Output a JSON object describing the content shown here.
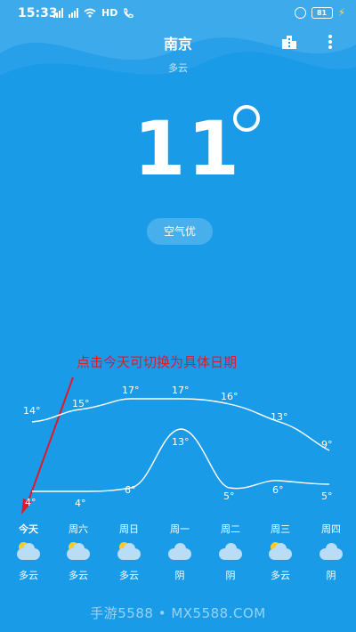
{
  "status_bar": {
    "time": "15:33",
    "network": "HD",
    "battery": "81"
  },
  "header": {
    "city": "南京",
    "condition": "多云"
  },
  "current": {
    "temperature": "11"
  },
  "air_quality": {
    "label": "空气优"
  },
  "annotation": {
    "text": "点击今天可切换为具体日期",
    "color": "#e0182b"
  },
  "forecast": {
    "highs": [
      "14°",
      "15°",
      "17°",
      "17°",
      "16°",
      "13°",
      "9°"
    ],
    "lows": [
      "4°",
      "4°",
      "6°",
      "13°",
      "5°",
      "6°",
      "5°"
    ],
    "days": [
      {
        "label": "今天",
        "icon": "partly-cloudy-icon",
        "condition": "多云"
      },
      {
        "label": "周六",
        "icon": "partly-cloudy-icon",
        "condition": "多云"
      },
      {
        "label": "周日",
        "icon": "partly-cloudy-icon",
        "condition": "多云"
      },
      {
        "label": "周一",
        "icon": "cloud-icon",
        "condition": "阴"
      },
      {
        "label": "周二",
        "icon": "cloud-icon",
        "condition": "阴"
      },
      {
        "label": "周三",
        "icon": "partly-cloudy-icon",
        "condition": "多云"
      },
      {
        "label": "周四",
        "icon": "cloud-icon",
        "condition": "阴"
      }
    ]
  },
  "watermark": "手游5588 • MX5588.COM",
  "colors": {
    "background": "#1a9be8",
    "cloud": "#b9dcf7",
    "sun": "#ffc928"
  }
}
